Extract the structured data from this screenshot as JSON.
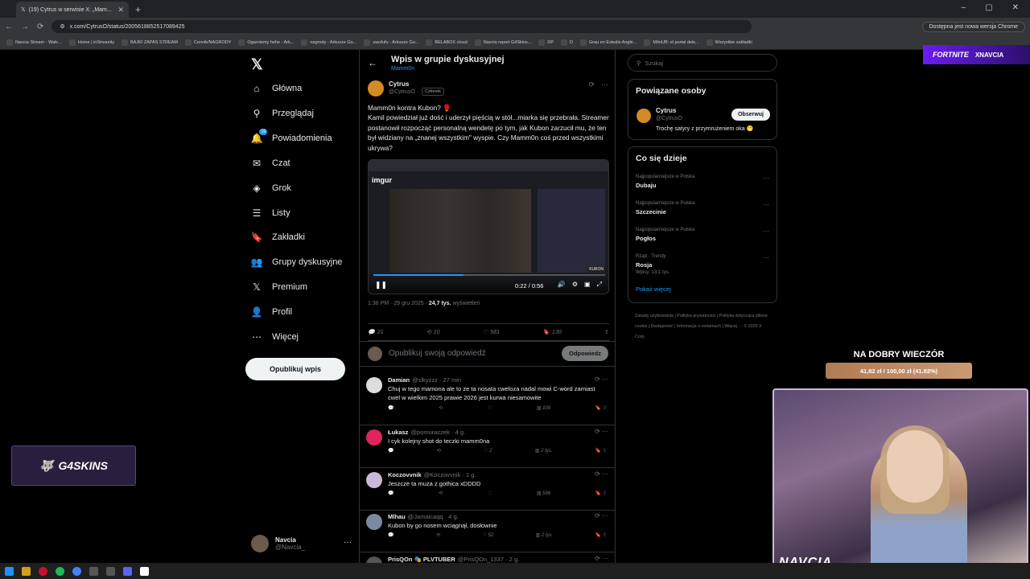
{
  "browser": {
    "tab_title": "(19) Cytrus w serwisie X: „Mam...",
    "url": "x.com/CytrusO/status/2005618852517089425",
    "update_label": "Dostępna jest nowa wersja Chrome",
    "bookmarks": [
      "Navcia Stream - Watc...",
      "Home | inStreamly",
      "BAJKI ZAPAS STREAM",
      "Cennik/NAGRODY",
      "Ogarniemy hehe - Ark...",
      "nagrody - Arkusze Go...",
      "uwufufu - Arkusze Go...",
      "BELABOX cloud",
      "Navcia report G4Skins...",
      "DP",
      "D",
      "Grau en Estudis Angle...",
      "MônUB: el portal dels...",
      "Wszystkie zakładki"
    ]
  },
  "nav": {
    "items": [
      "Główna",
      "Przeglądaj",
      "Powiadomienia",
      "Czat",
      "Grok",
      "Listy",
      "Zakładki",
      "Grupy dyskusyjne",
      "Premium",
      "Profil",
      "Więcej"
    ],
    "notif_badge": "19",
    "post_button": "Opublikuj wpis",
    "user_name": "Navcia",
    "user_handle": "@Navcia_"
  },
  "header": {
    "title": "Wpis w grupie dyskusyjnej",
    "subtitle": "Mamm0n"
  },
  "post": {
    "author": "Cytrus",
    "handle": "@CytrusO ·",
    "chip": "Członek",
    "line1": "Mamm0n kontra Kubon? 🥊",
    "body": "Kamil powiedział już dość i uderzył pięścią w stół...miarka się przebrała. Streamer postanowił rozpocząć personalną wendetę po tym, jak Kubon zarzucił mu, że ten był widziany na „znanej wszystkim\" wyspie. Czy Mamm0n coś przed wszystkimi ukrywa?",
    "video_time": "0:22 / 0:56",
    "video_progress": 0.39,
    "video_brand": "imgur",
    "video_tag": "KUBON",
    "meta_time": "1:36 PM · 29 gru 2025 ·",
    "views": "24,7 tys.",
    "views_label": "wyświetleń",
    "replies": "21",
    "reposts": "10",
    "likes": "581",
    "bookmarks": "130"
  },
  "reply_box": {
    "placeholder": "Opublikuj swoją odpowiedź",
    "button": "Odpowiedz"
  },
  "comments": [
    {
      "name": "Damian",
      "handle": "@slkyzzz · 27 min",
      "text": "Chuj w tego mamona ale to ze ta nosata cweloza nadal mowi C-word zamiast cwel w wielkim 2025 prawie 2026 jest kurwa niesamowite",
      "likes": "",
      "views": "109",
      "color": "#dddddd"
    },
    {
      "name": "Łukasz",
      "handle": "@pomuraczek · 4 g.",
      "text": "I cyk kolejny shot do teczki mamm0na",
      "likes": "2",
      "views": "2 tys.",
      "color": "#e0245e"
    },
    {
      "name": "Koczovvnik",
      "handle": "@Koczovvnik · 1 g.",
      "text": "Jeszcze ta muza z gothica xDDDD",
      "likes": "",
      "views": "596",
      "color": "#c9b8d8"
    },
    {
      "name": "Mlhau",
      "handle": "@Jamaicaqq · 4 g.",
      "text": "Kubon by go nosem wciągnął, dosłownie",
      "likes": "52",
      "views": "2 tys.",
      "color": "#7a8aa0"
    },
    {
      "name": "PrisQOn 🎭 PLVTUBER",
      "handle": "@PrisQOn_1337 · 2 g.",
      "text": "",
      "likes": "",
      "views": "",
      "color": "#555555"
    }
  ],
  "right": {
    "search_placeholder": "Szukaj",
    "related_title": "Powiązane osoby",
    "related_name": "Cytrus",
    "related_handle": "@CytrusO",
    "related_bio": "Trochę satyry z przymrużeniem oka 😁",
    "follow": "Obserwuj",
    "trends_title": "Co się dzieje",
    "trends": [
      {
        "cat": "Najpopularniejsze w Polska",
        "name": "Dubaju",
        "vol": ""
      },
      {
        "cat": "Najpopularniejsze w Polska",
        "name": "Szczecinie",
        "vol": ""
      },
      {
        "cat": "Najpopularniejsze w Polska",
        "name": "Pogłos",
        "vol": ""
      },
      {
        "cat": "Rząd · Trendy",
        "name": "Rosja",
        "vol": "Wpisy: 13,1 tys."
      }
    ],
    "show_more": "Pokaż więcej",
    "footer": "Zasady użytkowania | Polityka prywatności | Polityka dotycząca plików cookie | Dostępność | Informacje o reklamach | Więcej ··· © 2025 X Corp."
  },
  "overlays": {
    "fortnite": "FORTNITE",
    "creator": "XNAVCIA",
    "g4skins": "G4SKINS",
    "goal_title": "NA DOBRY WIECZÓR",
    "goal_text": "41,82 zł / 100,00 zł (41.82%)",
    "goal_progress": 0.4182,
    "cam_name": "NAVCIA"
  }
}
